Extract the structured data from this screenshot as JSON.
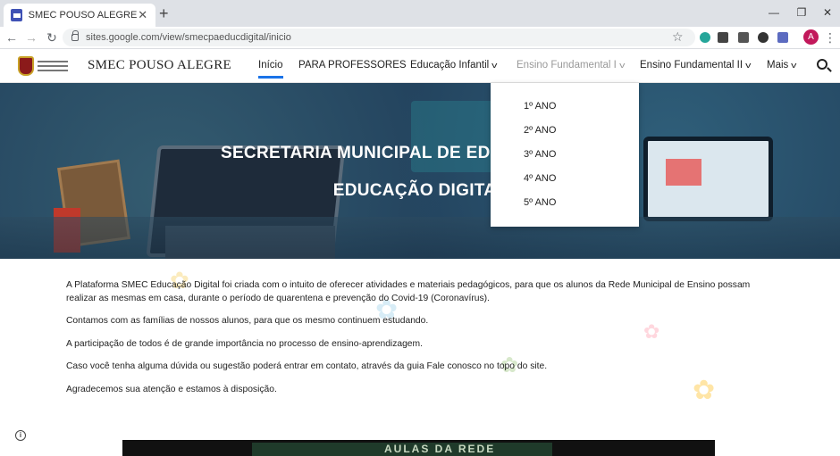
{
  "browser": {
    "tab_title": "SMEC POUSO ALEGRE",
    "url": "sites.google.com/view/smecpaeducdigital/inicio",
    "profile_initial": "A",
    "icons": {
      "close": "close-icon",
      "new_tab": "plus-icon",
      "back": "back-arrow-icon",
      "forward": "forward-arrow-icon",
      "reload": "reload-icon",
      "bookmark": "star-icon",
      "menu": "kebab-menu-icon"
    }
  },
  "site": {
    "title": "SMEC POUSO ALEGRE",
    "nav": {
      "inicio": "Início",
      "professores": "PARA PROFESSORES",
      "infantil": "Educação Infantil",
      "fund1": "Ensino Fundamental I",
      "fund2": "Ensino Fundamental II",
      "mais": "Mais"
    },
    "accent_color": "#1a73e8"
  },
  "hero": {
    "line1": "SECRETARIA MUNICIPAL DE EDUCAÇÃO PARA",
    "line2": "EDUCAÇÃO DIGITAL"
  },
  "dropdown": {
    "items": [
      "1º ANO",
      "2º ANO",
      "3º ANO",
      "4º ANO",
      "5º ANO"
    ]
  },
  "content": {
    "p1": "A Plataforma SMEC Educação Digital foi criada com o intuito de oferecer atividades e materiais pedagógicos, para que os alunos da Rede Municipal de Ensino possam realizar as mesmas em casa, durante o período de quarentena e prevenção do Covid-19 (Coronavírus).",
    "p2": "Contamos com as famílias de nossos alunos, para que os mesmo continuem estudando.",
    "p3": "A participação de todos é de grande importância no processo de ensino-aprendizagem.",
    "p4": "Caso você tenha alguma dúvida ou sugestão poderá entrar em contato, através da guia Fale conosco no topo do site.",
    "p5": "Agradecemos sua atenção e estamos à disposição."
  },
  "video": {
    "caption": "AULAS DA REDE"
  }
}
